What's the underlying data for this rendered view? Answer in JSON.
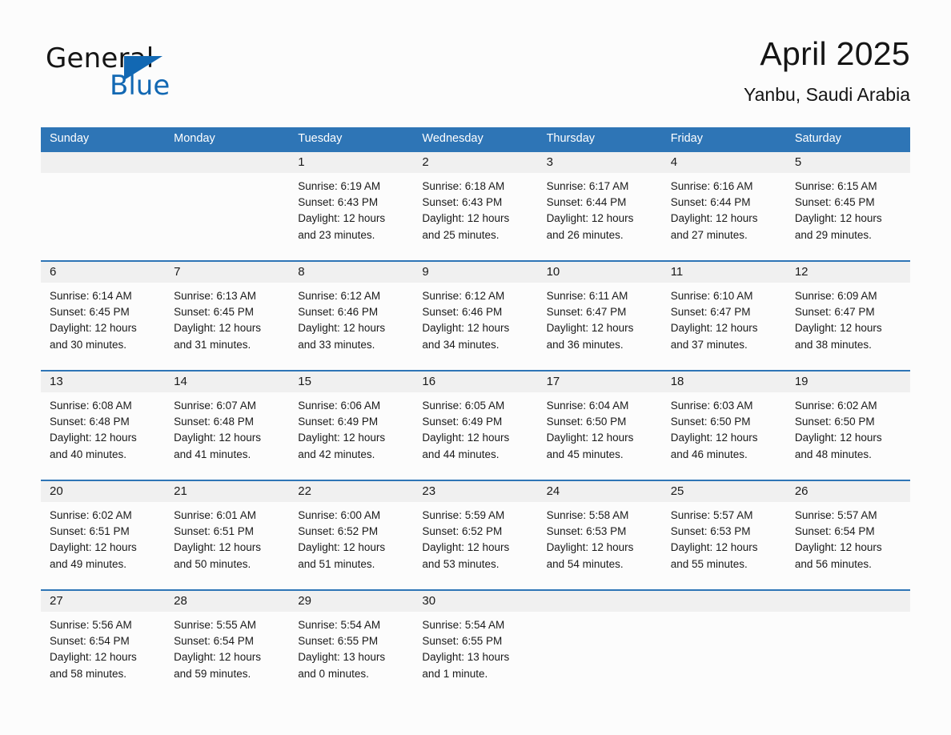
{
  "brand": {
    "name_top": "General",
    "name_bottom": "Blue",
    "triangle_color": "#1268b3",
    "text_color": "#151515"
  },
  "header": {
    "title": "April 2025",
    "subtitle": "Yanbu, Saudi Arabia"
  },
  "colors": {
    "header_blue": "#2e75b6",
    "daynum_band": "#f0f0f0",
    "page_background": "#fcfcfc",
    "text": "#1a1a1a"
  },
  "weekdays": [
    "Sunday",
    "Monday",
    "Tuesday",
    "Wednesday",
    "Thursday",
    "Friday",
    "Saturday"
  ],
  "labels": {
    "sunrise_prefix": "Sunrise:",
    "sunset_prefix": "Sunset:",
    "daylight_prefix": "Daylight:"
  },
  "weeks": [
    [
      {
        "day": "",
        "sunrise": "",
        "sunset": "",
        "daylight_line1": "",
        "daylight_line2": ""
      },
      {
        "day": "",
        "sunrise": "",
        "sunset": "",
        "daylight_line1": "",
        "daylight_line2": ""
      },
      {
        "day": "1",
        "sunrise": "Sunrise: 6:19 AM",
        "sunset": "Sunset: 6:43 PM",
        "daylight_line1": "Daylight: 12 hours",
        "daylight_line2": "and 23 minutes."
      },
      {
        "day": "2",
        "sunrise": "Sunrise: 6:18 AM",
        "sunset": "Sunset: 6:43 PM",
        "daylight_line1": "Daylight: 12 hours",
        "daylight_line2": "and 25 minutes."
      },
      {
        "day": "3",
        "sunrise": "Sunrise: 6:17 AM",
        "sunset": "Sunset: 6:44 PM",
        "daylight_line1": "Daylight: 12 hours",
        "daylight_line2": "and 26 minutes."
      },
      {
        "day": "4",
        "sunrise": "Sunrise: 6:16 AM",
        "sunset": "Sunset: 6:44 PM",
        "daylight_line1": "Daylight: 12 hours",
        "daylight_line2": "and 27 minutes."
      },
      {
        "day": "5",
        "sunrise": "Sunrise: 6:15 AM",
        "sunset": "Sunset: 6:45 PM",
        "daylight_line1": "Daylight: 12 hours",
        "daylight_line2": "and 29 minutes."
      }
    ],
    [
      {
        "day": "6",
        "sunrise": "Sunrise: 6:14 AM",
        "sunset": "Sunset: 6:45 PM",
        "daylight_line1": "Daylight: 12 hours",
        "daylight_line2": "and 30 minutes."
      },
      {
        "day": "7",
        "sunrise": "Sunrise: 6:13 AM",
        "sunset": "Sunset: 6:45 PM",
        "daylight_line1": "Daylight: 12 hours",
        "daylight_line2": "and 31 minutes."
      },
      {
        "day": "8",
        "sunrise": "Sunrise: 6:12 AM",
        "sunset": "Sunset: 6:46 PM",
        "daylight_line1": "Daylight: 12 hours",
        "daylight_line2": "and 33 minutes."
      },
      {
        "day": "9",
        "sunrise": "Sunrise: 6:12 AM",
        "sunset": "Sunset: 6:46 PM",
        "daylight_line1": "Daylight: 12 hours",
        "daylight_line2": "and 34 minutes."
      },
      {
        "day": "10",
        "sunrise": "Sunrise: 6:11 AM",
        "sunset": "Sunset: 6:47 PM",
        "daylight_line1": "Daylight: 12 hours",
        "daylight_line2": "and 36 minutes."
      },
      {
        "day": "11",
        "sunrise": "Sunrise: 6:10 AM",
        "sunset": "Sunset: 6:47 PM",
        "daylight_line1": "Daylight: 12 hours",
        "daylight_line2": "and 37 minutes."
      },
      {
        "day": "12",
        "sunrise": "Sunrise: 6:09 AM",
        "sunset": "Sunset: 6:47 PM",
        "daylight_line1": "Daylight: 12 hours",
        "daylight_line2": "and 38 minutes."
      }
    ],
    [
      {
        "day": "13",
        "sunrise": "Sunrise: 6:08 AM",
        "sunset": "Sunset: 6:48 PM",
        "daylight_line1": "Daylight: 12 hours",
        "daylight_line2": "and 40 minutes."
      },
      {
        "day": "14",
        "sunrise": "Sunrise: 6:07 AM",
        "sunset": "Sunset: 6:48 PM",
        "daylight_line1": "Daylight: 12 hours",
        "daylight_line2": "and 41 minutes."
      },
      {
        "day": "15",
        "sunrise": "Sunrise: 6:06 AM",
        "sunset": "Sunset: 6:49 PM",
        "daylight_line1": "Daylight: 12 hours",
        "daylight_line2": "and 42 minutes."
      },
      {
        "day": "16",
        "sunrise": "Sunrise: 6:05 AM",
        "sunset": "Sunset: 6:49 PM",
        "daylight_line1": "Daylight: 12 hours",
        "daylight_line2": "and 44 minutes."
      },
      {
        "day": "17",
        "sunrise": "Sunrise: 6:04 AM",
        "sunset": "Sunset: 6:50 PM",
        "daylight_line1": "Daylight: 12 hours",
        "daylight_line2": "and 45 minutes."
      },
      {
        "day": "18",
        "sunrise": "Sunrise: 6:03 AM",
        "sunset": "Sunset: 6:50 PM",
        "daylight_line1": "Daylight: 12 hours",
        "daylight_line2": "and 46 minutes."
      },
      {
        "day": "19",
        "sunrise": "Sunrise: 6:02 AM",
        "sunset": "Sunset: 6:50 PM",
        "daylight_line1": "Daylight: 12 hours",
        "daylight_line2": "and 48 minutes."
      }
    ],
    [
      {
        "day": "20",
        "sunrise": "Sunrise: 6:02 AM",
        "sunset": "Sunset: 6:51 PM",
        "daylight_line1": "Daylight: 12 hours",
        "daylight_line2": "and 49 minutes."
      },
      {
        "day": "21",
        "sunrise": "Sunrise: 6:01 AM",
        "sunset": "Sunset: 6:51 PM",
        "daylight_line1": "Daylight: 12 hours",
        "daylight_line2": "and 50 minutes."
      },
      {
        "day": "22",
        "sunrise": "Sunrise: 6:00 AM",
        "sunset": "Sunset: 6:52 PM",
        "daylight_line1": "Daylight: 12 hours",
        "daylight_line2": "and 51 minutes."
      },
      {
        "day": "23",
        "sunrise": "Sunrise: 5:59 AM",
        "sunset": "Sunset: 6:52 PM",
        "daylight_line1": "Daylight: 12 hours",
        "daylight_line2": "and 53 minutes."
      },
      {
        "day": "24",
        "sunrise": "Sunrise: 5:58 AM",
        "sunset": "Sunset: 6:53 PM",
        "daylight_line1": "Daylight: 12 hours",
        "daylight_line2": "and 54 minutes."
      },
      {
        "day": "25",
        "sunrise": "Sunrise: 5:57 AM",
        "sunset": "Sunset: 6:53 PM",
        "daylight_line1": "Daylight: 12 hours",
        "daylight_line2": "and 55 minutes."
      },
      {
        "day": "26",
        "sunrise": "Sunrise: 5:57 AM",
        "sunset": "Sunset: 6:54 PM",
        "daylight_line1": "Daylight: 12 hours",
        "daylight_line2": "and 56 minutes."
      }
    ],
    [
      {
        "day": "27",
        "sunrise": "Sunrise: 5:56 AM",
        "sunset": "Sunset: 6:54 PM",
        "daylight_line1": "Daylight: 12 hours",
        "daylight_line2": "and 58 minutes."
      },
      {
        "day": "28",
        "sunrise": "Sunrise: 5:55 AM",
        "sunset": "Sunset: 6:54 PM",
        "daylight_line1": "Daylight: 12 hours",
        "daylight_line2": "and 59 minutes."
      },
      {
        "day": "29",
        "sunrise": "Sunrise: 5:54 AM",
        "sunset": "Sunset: 6:55 PM",
        "daylight_line1": "Daylight: 13 hours",
        "daylight_line2": "and 0 minutes."
      },
      {
        "day": "30",
        "sunrise": "Sunrise: 5:54 AM",
        "sunset": "Sunset: 6:55 PM",
        "daylight_line1": "Daylight: 13 hours",
        "daylight_line2": "and 1 minute."
      },
      {
        "day": "",
        "sunrise": "",
        "sunset": "",
        "daylight_line1": "",
        "daylight_line2": ""
      },
      {
        "day": "",
        "sunrise": "",
        "sunset": "",
        "daylight_line1": "",
        "daylight_line2": ""
      },
      {
        "day": "",
        "sunrise": "",
        "sunset": "",
        "daylight_line1": "",
        "daylight_line2": ""
      }
    ]
  ]
}
